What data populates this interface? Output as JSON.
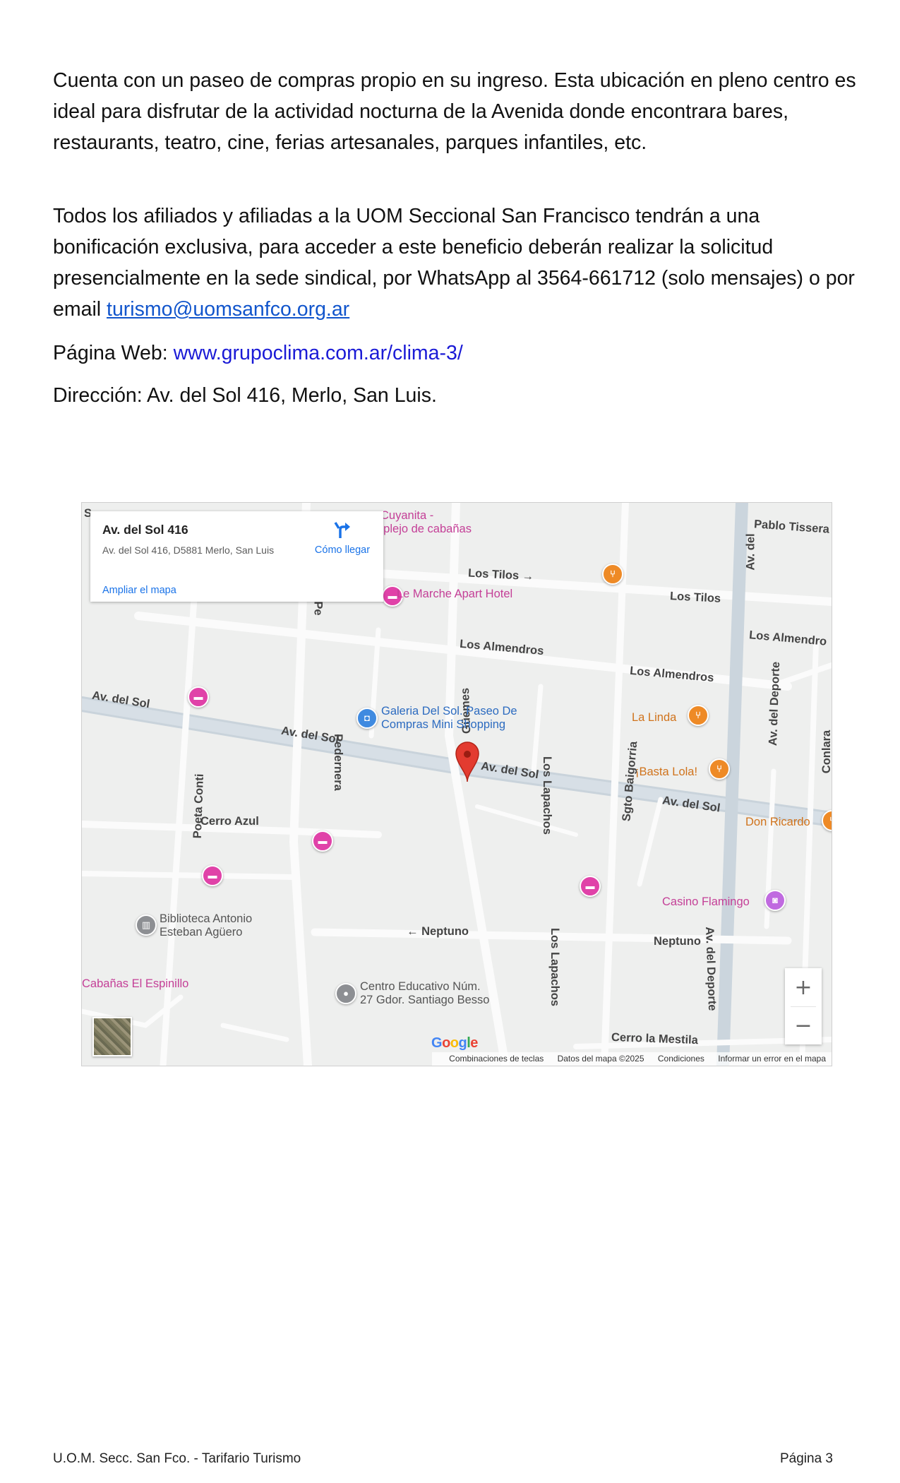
{
  "body": {
    "para1": "Cuenta con un paseo de compras propio en su ingreso. Esta ubicación en pleno centro es ideal para disfrutar de la actividad nocturna de la Avenida donde encontrara bares, restaurants, teatro, cine, ferias artesanales, parques infantiles, etc.",
    "para2_text": "Todos los afiliados y afiliadas a la UOM Seccional San Francisco tendrán a una bonificación exclusiva, para acceder a este beneficio deberán realizar la solicitud presencialmente en la sede sindical, por WhatsApp al 3564-661712 (solo mensajes) o por email ",
    "para2_email": "turismo@uomsanfco.org.ar",
    "web_label": "Página Web: ",
    "web_url": "www.grupoclima.com.ar/clima-3/",
    "address_line": "Dirección: Av. del Sol 416, Merlo, San Luis."
  },
  "map": {
    "card": {
      "title": "Av. del Sol 416",
      "address": "Av. del Sol 416, D5881 Merlo, San Luis",
      "directions_label": "Cómo llegar",
      "enlarge_label": "Ampliar el mapa"
    },
    "streets": {
      "av_del_sol_1": "Av. del Sol",
      "av_del_sol_2": "Av. del Sol",
      "av_del_sol_3": "Av. del Sol",
      "av_del_sol_4": "Av. del Sol",
      "los_tilos_1": "Los Tilos →",
      "los_tilos_2": "Los Tilos",
      "los_almendros_1": "Los Almendros",
      "los_almendros_2": "Los Almendros",
      "los_almendros_3": "Los Almendro",
      "pablo_tissera": "Pablo Tissera",
      "av_del_deporte_1": "Av. del Deporte",
      "av_del_deporte_2": "Av. del Deporte",
      "av_del_top": "Av. del",
      "guemes": "Güemes",
      "sgto_baigorria": "Sgto Baigorria",
      "conlara": "Conlara",
      "poeta_conti": "Poeta Conti",
      "pedernera": "Pedernera",
      "pe": "Pe",
      "los_lapachos_1": "Los Lapachos",
      "los_lapachos_2": "Los Lapachos",
      "cerro_azul": "Cerro Azul",
      "neptuno_1": "← Neptuno",
      "neptuno_2": "Neptuno",
      "cerro_la_mestila": "Cerro la Mestila",
      "s_top": "S"
    },
    "pois": {
      "cuyanita": "Cuyanita -",
      "cabanas": "nplejo de cabañas",
      "le_marche": "Le Marche Apart Hotel",
      "galeria_1": "Galeria Del Sol. Paseo De",
      "galeria_2": "Compras Mini Shopping",
      "la_linda": "La Linda",
      "basta_lola": "¡Basta Lola!",
      "don_ricardo": "Don Ricardo",
      "casino": "Casino Flamingo",
      "biblioteca_1": "Biblioteca Antonio",
      "biblioteca_2": "Esteban Agüero",
      "espinillo": "Cabañas El Espinillo",
      "centro_1": "Centro Educativo Núm.",
      "centro_2": "27 Gdor. Santiago Besso"
    },
    "controls": {
      "zoom_in": "+",
      "zoom_out": "−"
    },
    "brand": {
      "g1": "G",
      "g2": "o",
      "g3": "o",
      "g4": "g",
      "g5": "l",
      "g6": "e"
    },
    "attribution": {
      "shortcuts": "Combinaciones de teclas",
      "map_data": "Datos del mapa ©2025",
      "terms": "Condiciones",
      "report": "Informar un error en el mapa"
    }
  },
  "footer": {
    "left": "U.O.M. Secc. San Fco. - Tarifario Turismo",
    "right": "Página 3"
  },
  "colors": {
    "email_link": "#1155cc",
    "web_link": "#1a1ad6",
    "marker_red": "#e33b30",
    "poi_pink": "#e042a8",
    "poi_orange": "#ee8a26",
    "map_link": "#1a73e8"
  }
}
